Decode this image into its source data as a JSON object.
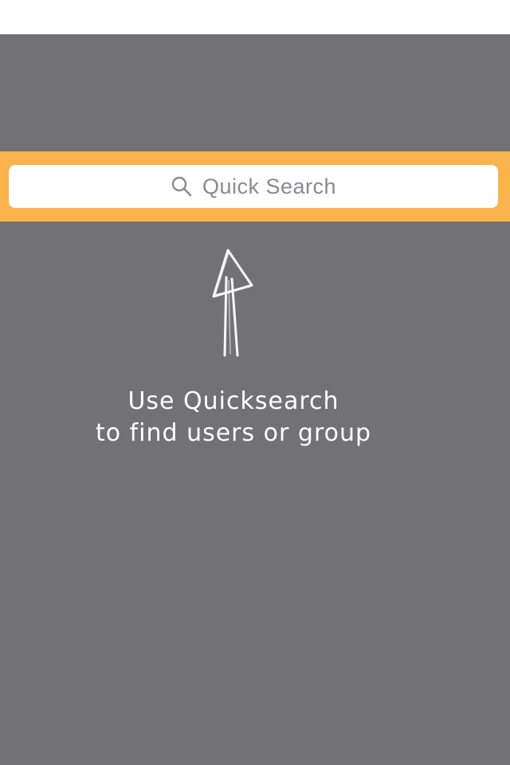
{
  "search": {
    "placeholder": "Quick Search",
    "icon": "search-icon"
  },
  "hint": {
    "line1": "Use Quicksearch",
    "line2": "to find users or group",
    "arrow_icon": "hand-drawn-up-arrow-icon"
  },
  "colors": {
    "overlay": "#727174",
    "search_strip": "#fbb34b",
    "search_field": "#ffffff",
    "hint_text": "#ffffff"
  }
}
